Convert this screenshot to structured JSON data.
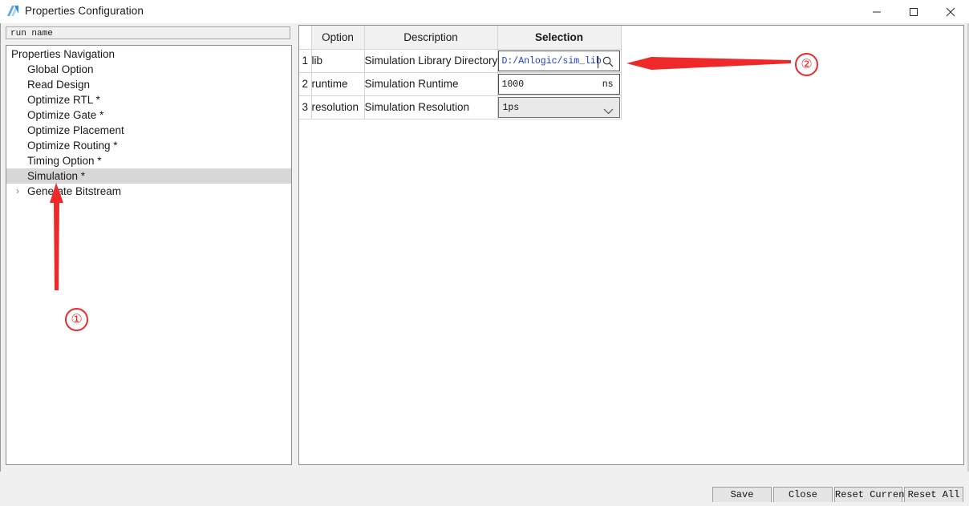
{
  "window": {
    "title": "Properties Configuration",
    "icon": "anlogic-logo-icon",
    "minimize_label": "–",
    "maximize_label": "□",
    "close_label": "×"
  },
  "left_panel": {
    "run_name_value": "run name",
    "run_name_placeholder": "run name",
    "nav_title": "Properties Navigation",
    "items": [
      {
        "label": "Global Option",
        "selected": false,
        "expandable": false
      },
      {
        "label": "Read Design",
        "selected": false,
        "expandable": false
      },
      {
        "label": "Optimize RTL *",
        "selected": false,
        "expandable": false
      },
      {
        "label": "Optimize Gate *",
        "selected": false,
        "expandable": false
      },
      {
        "label": "Optimize Placement",
        "selected": false,
        "expandable": false
      },
      {
        "label": "Optimize Routing *",
        "selected": false,
        "expandable": false
      },
      {
        "label": "Timing Option *",
        "selected": false,
        "expandable": false
      },
      {
        "label": "Simulation *",
        "selected": true,
        "expandable": false
      },
      {
        "label": "Generate Bitstream",
        "selected": false,
        "expandable": true
      }
    ],
    "expand_chevron": "›"
  },
  "table": {
    "headers": {
      "rownum": "",
      "option": "Option",
      "description": "Description",
      "selection": "Selection"
    },
    "rows": [
      {
        "num": "1",
        "option": "lib",
        "description": "Simulation Library Directory",
        "selection_value": "D:/Anlogic/sim_lib",
        "selection_type": "text-with-browse",
        "value_color": "#1a3fd0",
        "suffix": "",
        "icon": "search-icon"
      },
      {
        "num": "2",
        "option": "runtime",
        "description": "Simulation Runtime",
        "selection_value": "1000",
        "selection_type": "text-with-unit",
        "value_color": "#111111",
        "suffix": "ns",
        "icon": ""
      },
      {
        "num": "3",
        "option": "resolution",
        "description": "Simulation Resolution",
        "selection_value": "1ps",
        "selection_type": "dropdown",
        "value_color": "#111111",
        "suffix": "",
        "icon": "chevron-down-icon"
      }
    ]
  },
  "footer": {
    "save_label": "Save",
    "close_label": "Close",
    "reset_current_label": "Reset Current",
    "reset_all_label": "Reset All"
  },
  "annotations": {
    "marker_one": "①",
    "marker_two": "②",
    "arrow_color": "#ef2929"
  }
}
